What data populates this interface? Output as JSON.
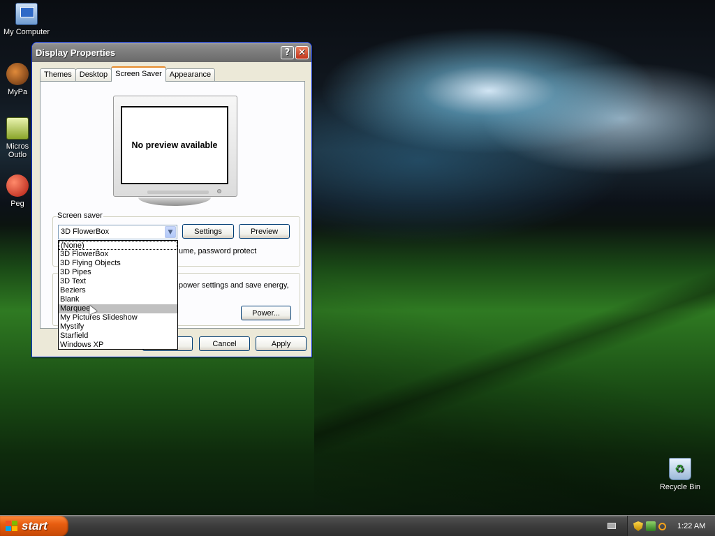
{
  "desktop": {
    "icons": [
      {
        "label": "My Computer"
      },
      {
        "label": "MyPa"
      },
      {
        "label": "Micros Outlo"
      },
      {
        "label": "Peg"
      },
      {
        "label": "Recycle Bin"
      }
    ]
  },
  "window": {
    "title": "Display Properties",
    "help_glyph": "?",
    "close_glyph": "✕",
    "tabs": [
      {
        "label": "Themes"
      },
      {
        "label": "Desktop"
      },
      {
        "label": "Screen Saver"
      },
      {
        "label": "Appearance"
      }
    ],
    "active_tab": "Screen Saver",
    "preview_text": "No preview available",
    "screensaver_group_label": "Screen saver",
    "selected_screensaver": "3D FlowerBox",
    "settings_button": "Settings",
    "preview_button": "Preview",
    "partial_resume_text": "ume, password protect",
    "partial_power_text": "power settings and save energy,",
    "power_button": "Power...",
    "ok_button": "",
    "cancel_button": "Cancel",
    "apply_button": "Apply",
    "dropdown_options": [
      "(None)",
      "3D FlowerBox",
      "3D Flying Objects",
      "3D Pipes",
      "3D Text",
      "Beziers",
      "Blank",
      "Marquee",
      "My Pictures Slideshow",
      "Mystify",
      "Starfield",
      "Windows XP"
    ],
    "highlighted_option": "Marquee"
  },
  "taskbar": {
    "start_label": "start",
    "clock": "1:22 AM"
  },
  "colors": {
    "window_bg": "#ece9d8",
    "titlebar": "#7b7b7b",
    "active_tab_accent": "#e68b2c",
    "start_button": "#e75d10",
    "close_button": "#c2351c"
  }
}
